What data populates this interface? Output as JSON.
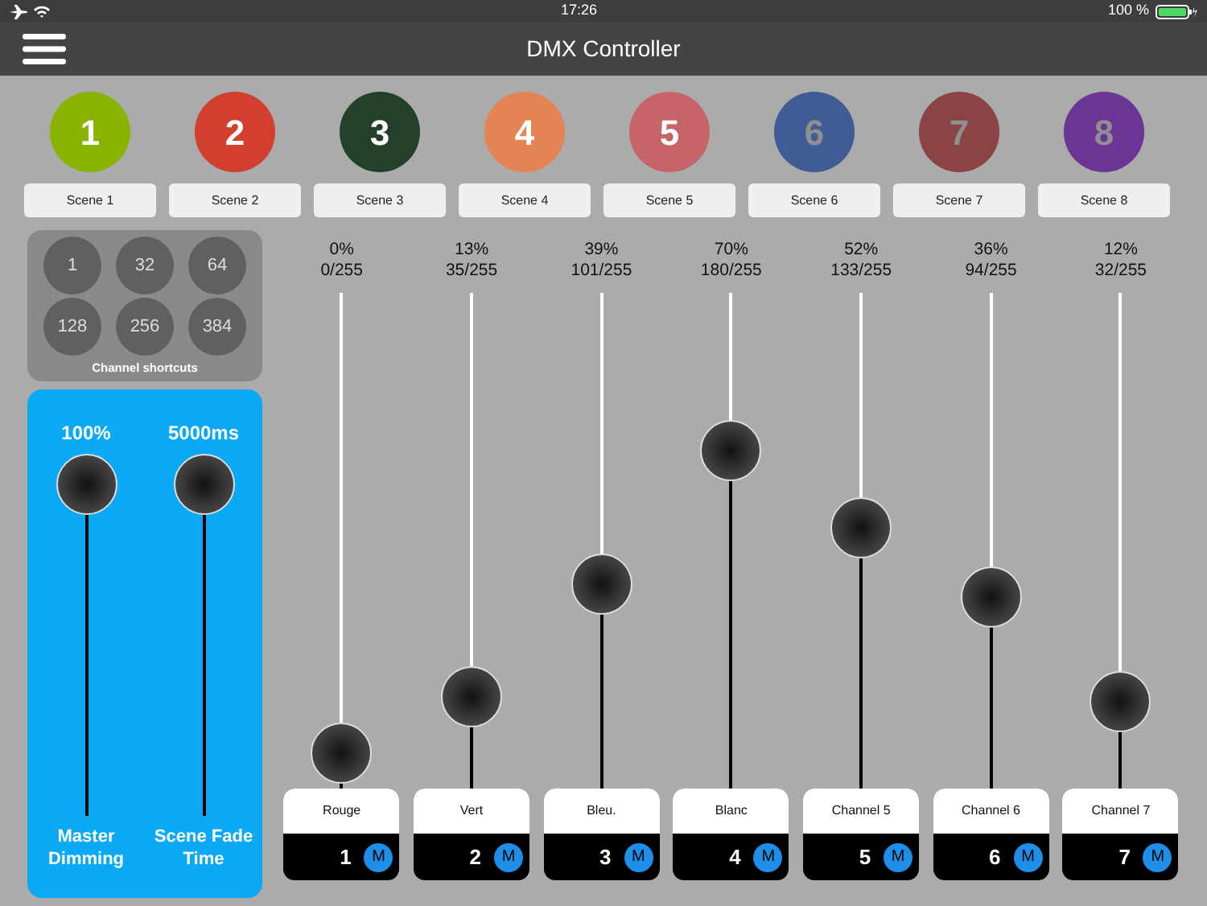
{
  "status_bar": {
    "time": "17:26",
    "battery": "100 %"
  },
  "window": {
    "title": "DMX Controller"
  },
  "scenes": [
    {
      "number": "1",
      "label": "Scene 1",
      "color": "#8ab300",
      "active": true
    },
    {
      "number": "2",
      "label": "Scene 2",
      "color": "#d23f2e",
      "active": true
    },
    {
      "number": "3",
      "label": "Scene 3",
      "color": "#23402b",
      "active": true
    },
    {
      "number": "4",
      "label": "Scene 4",
      "color": "#e48455",
      "active": true
    },
    {
      "number": "5",
      "label": "Scene 5",
      "color": "#c66468",
      "active": true
    },
    {
      "number": "6",
      "label": "Scene 6",
      "color": "#3f5c95",
      "active": false
    },
    {
      "number": "7",
      "label": "Scene 7",
      "color": "#8b4446",
      "active": false
    },
    {
      "number": "8",
      "label": "Scene 8",
      "color": "#6a3594",
      "active": false
    }
  ],
  "shortcuts": {
    "buttons": [
      "1",
      "32",
      "64",
      "128",
      "256",
      "384"
    ],
    "label": "Channel shortcuts"
  },
  "master": [
    {
      "reading": "100%",
      "label": "Master Dimming",
      "level": 1
    },
    {
      "reading": "5000ms",
      "label": "Scene Fade Time",
      "level": 1
    }
  ],
  "channels": [
    {
      "percent": "0%",
      "value": "0/255",
      "level": 0,
      "name": "Rouge",
      "number": "1",
      "m": "M"
    },
    {
      "percent": "13%",
      "value": "35/255",
      "level": 0.13,
      "name": "Vert",
      "number": "2",
      "m": "M"
    },
    {
      "percent": "39%",
      "value": "101/255",
      "level": 0.39,
      "name": "Bleu.",
      "number": "3",
      "m": "M"
    },
    {
      "percent": "70%",
      "value": "180/255",
      "level": 0.7,
      "name": "Blanc",
      "number": "4",
      "m": "M"
    },
    {
      "percent": "52%",
      "value": "133/255",
      "level": 0.52,
      "name": "Channel 5",
      "number": "5",
      "m": "M"
    },
    {
      "percent": "36%",
      "value": "94/255",
      "level": 0.36,
      "name": "Channel 6",
      "number": "6",
      "m": "M"
    },
    {
      "percent": "12%",
      "value": "32/255",
      "level": 0.12,
      "name": "Channel 7",
      "number": "7",
      "m": "M"
    }
  ]
}
